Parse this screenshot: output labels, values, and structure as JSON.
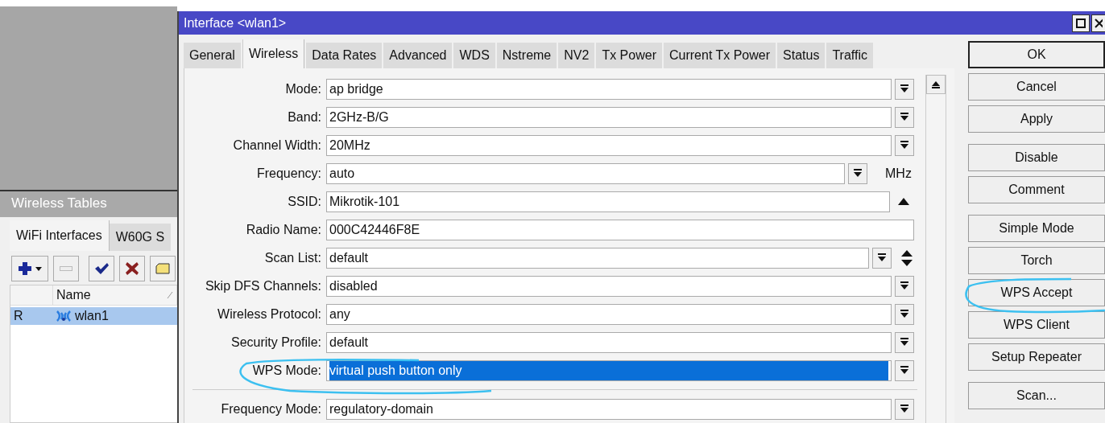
{
  "side_window": {
    "title": "Wireless Tables",
    "tabs": [
      {
        "label": "WiFi Interfaces",
        "selected": true
      },
      {
        "label": "W60G S",
        "selected": false
      }
    ],
    "table": {
      "columns": [
        "",
        "Name"
      ],
      "rows": [
        {
          "flag": "R",
          "name": "wlan1",
          "selected": true
        }
      ]
    }
  },
  "dialog": {
    "title": "Interface <wlan1>",
    "tabs": [
      {
        "label": "General",
        "selected": false
      },
      {
        "label": "Wireless",
        "selected": true
      },
      {
        "label": "Data Rates",
        "selected": false
      },
      {
        "label": "Advanced",
        "selected": false
      },
      {
        "label": "WDS",
        "selected": false
      },
      {
        "label": "Nstreme",
        "selected": false
      },
      {
        "label": "NV2",
        "selected": false
      },
      {
        "label": "Tx Power",
        "selected": false
      },
      {
        "label": "Current Tx Power",
        "selected": false
      },
      {
        "label": "Status",
        "selected": false
      },
      {
        "label": "Traffic",
        "selected": false
      }
    ],
    "sections": [
      [
        {
          "label": "Mode:",
          "value": "ap bridge",
          "kind": "dropdown",
          "selected": false
        },
        {
          "label": "Band:",
          "value": "2GHz-B/G",
          "kind": "dropdown",
          "selected": false
        },
        {
          "label": "Channel Width:",
          "value": "20MHz",
          "kind": "dropdown",
          "selected": false
        },
        {
          "label": "Frequency:",
          "value": "auto",
          "kind": "unit",
          "unit": "MHz",
          "selected": false
        },
        {
          "label": "SSID:",
          "value": "Mikrotik-101",
          "kind": "collapse",
          "selected": false
        },
        {
          "label": "Radio Name:",
          "value": "000C42446F8E",
          "kind": "plain",
          "selected": false
        },
        {
          "label": "Scan List:",
          "value": "default",
          "kind": "multi",
          "selected": false
        },
        {
          "label": "Skip DFS Channels:",
          "value": "disabled",
          "kind": "dropdown",
          "selected": false
        },
        {
          "label": "Wireless Protocol:",
          "value": "any",
          "kind": "dropdown",
          "selected": false
        },
        {
          "label": "Security Profile:",
          "value": "default",
          "kind": "dropdown",
          "selected": false
        },
        {
          "label": "WPS Mode:",
          "value": "virtual push button only",
          "kind": "dropdown",
          "selected": true
        }
      ],
      [
        {
          "label": "Frequency Mode:",
          "value": "regulatory-domain",
          "kind": "dropdown",
          "selected": false
        }
      ]
    ],
    "button_groups": [
      [
        {
          "label": "OK",
          "default": true
        },
        {
          "label": "Cancel",
          "default": false
        },
        {
          "label": "Apply",
          "default": false
        }
      ],
      [
        {
          "label": "Disable",
          "default": false
        },
        {
          "label": "Comment",
          "default": false
        }
      ],
      [
        {
          "label": "Simple Mode",
          "default": false
        },
        {
          "label": "Torch",
          "default": false
        },
        {
          "label": "WPS Accept",
          "default": false
        },
        {
          "label": "WPS Client",
          "default": false
        },
        {
          "label": "Setup Repeater",
          "default": false
        }
      ],
      [
        {
          "label": "Scan...",
          "default": false
        }
      ]
    ]
  }
}
